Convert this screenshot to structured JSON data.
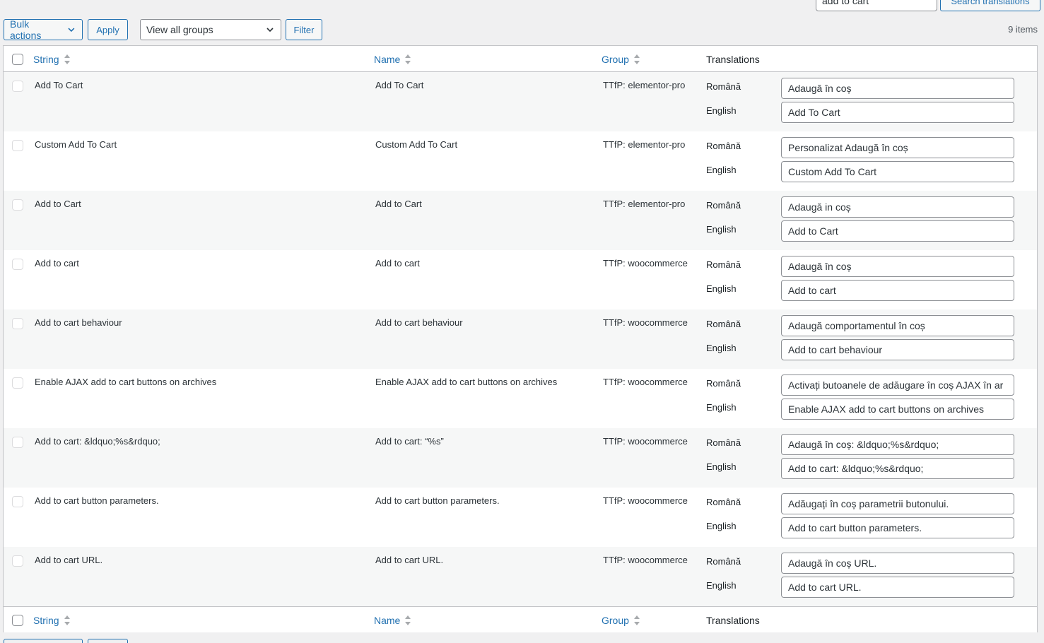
{
  "search": {
    "value": "add to cart",
    "button_label": "Search translations"
  },
  "toolbar": {
    "bulk_actions_label": "Bulk actions",
    "apply_label": "Apply",
    "groups_selected": "View all groups",
    "filter_label": "Filter",
    "items_count": "9 items"
  },
  "columns": {
    "string": "String",
    "name": "Name",
    "group": "Group",
    "translations": "Translations"
  },
  "languages": {
    "ro": "Română",
    "en": "English"
  },
  "rows": [
    {
      "string": "Add To Cart",
      "name": "Add To Cart",
      "group": "TTfP: elementor-pro",
      "ro": "Adaugă în coș",
      "en": "Add To Cart"
    },
    {
      "string": "Custom Add To Cart",
      "name": "Custom Add To Cart",
      "group": "TTfP: elementor-pro",
      "ro": "Personalizat Adaugă în coș",
      "en": "Custom Add To Cart"
    },
    {
      "string": "Add to Cart",
      "name": "Add to Cart",
      "group": "TTfP: elementor-pro",
      "ro": "Adaugă in coș",
      "en": "Add to Cart"
    },
    {
      "string": "Add to cart",
      "name": "Add to cart",
      "group": "TTfP: woocommerce",
      "ro": "Adaugă în coș",
      "en": "Add to cart"
    },
    {
      "string": "Add to cart behaviour",
      "name": "Add to cart behaviour",
      "group": "TTfP: woocommerce",
      "ro": "Adaugă comportamentul în coș",
      "en": "Add to cart behaviour"
    },
    {
      "string": "Enable AJAX add to cart buttons on archives",
      "name": "Enable AJAX add to cart buttons on archives",
      "group": "TTfP: woocommerce",
      "ro": "Activați butoanele de adăugare în coș AJAX în ar",
      "en": "Enable AJAX add to cart buttons on archives"
    },
    {
      "string": "Add to cart: &ldquo;%s&rdquo;",
      "name": "Add to cart: “%s”",
      "group": "TTfP: woocommerce",
      "ro": "Adaugă în coș: &ldquo;%s&rdquo;",
      "en": "Add to cart: &ldquo;%s&rdquo;"
    },
    {
      "string": "Add to cart button parameters.",
      "name": "Add to cart button parameters.",
      "group": "TTfP: woocommerce",
      "ro": "Adăugați în coș parametrii butonului.",
      "en": "Add to cart button parameters."
    },
    {
      "string": "Add to cart URL.",
      "name": "Add to cart URL.",
      "group": "TTfP: woocommerce",
      "ro": "Adaugă în coș URL.",
      "en": "Add to cart URL."
    }
  ],
  "colors": {
    "accent": "#2271b1",
    "background": "#f0f0f1",
    "border": "#c3c4c7",
    "alt_row": "#f6f7f7"
  }
}
